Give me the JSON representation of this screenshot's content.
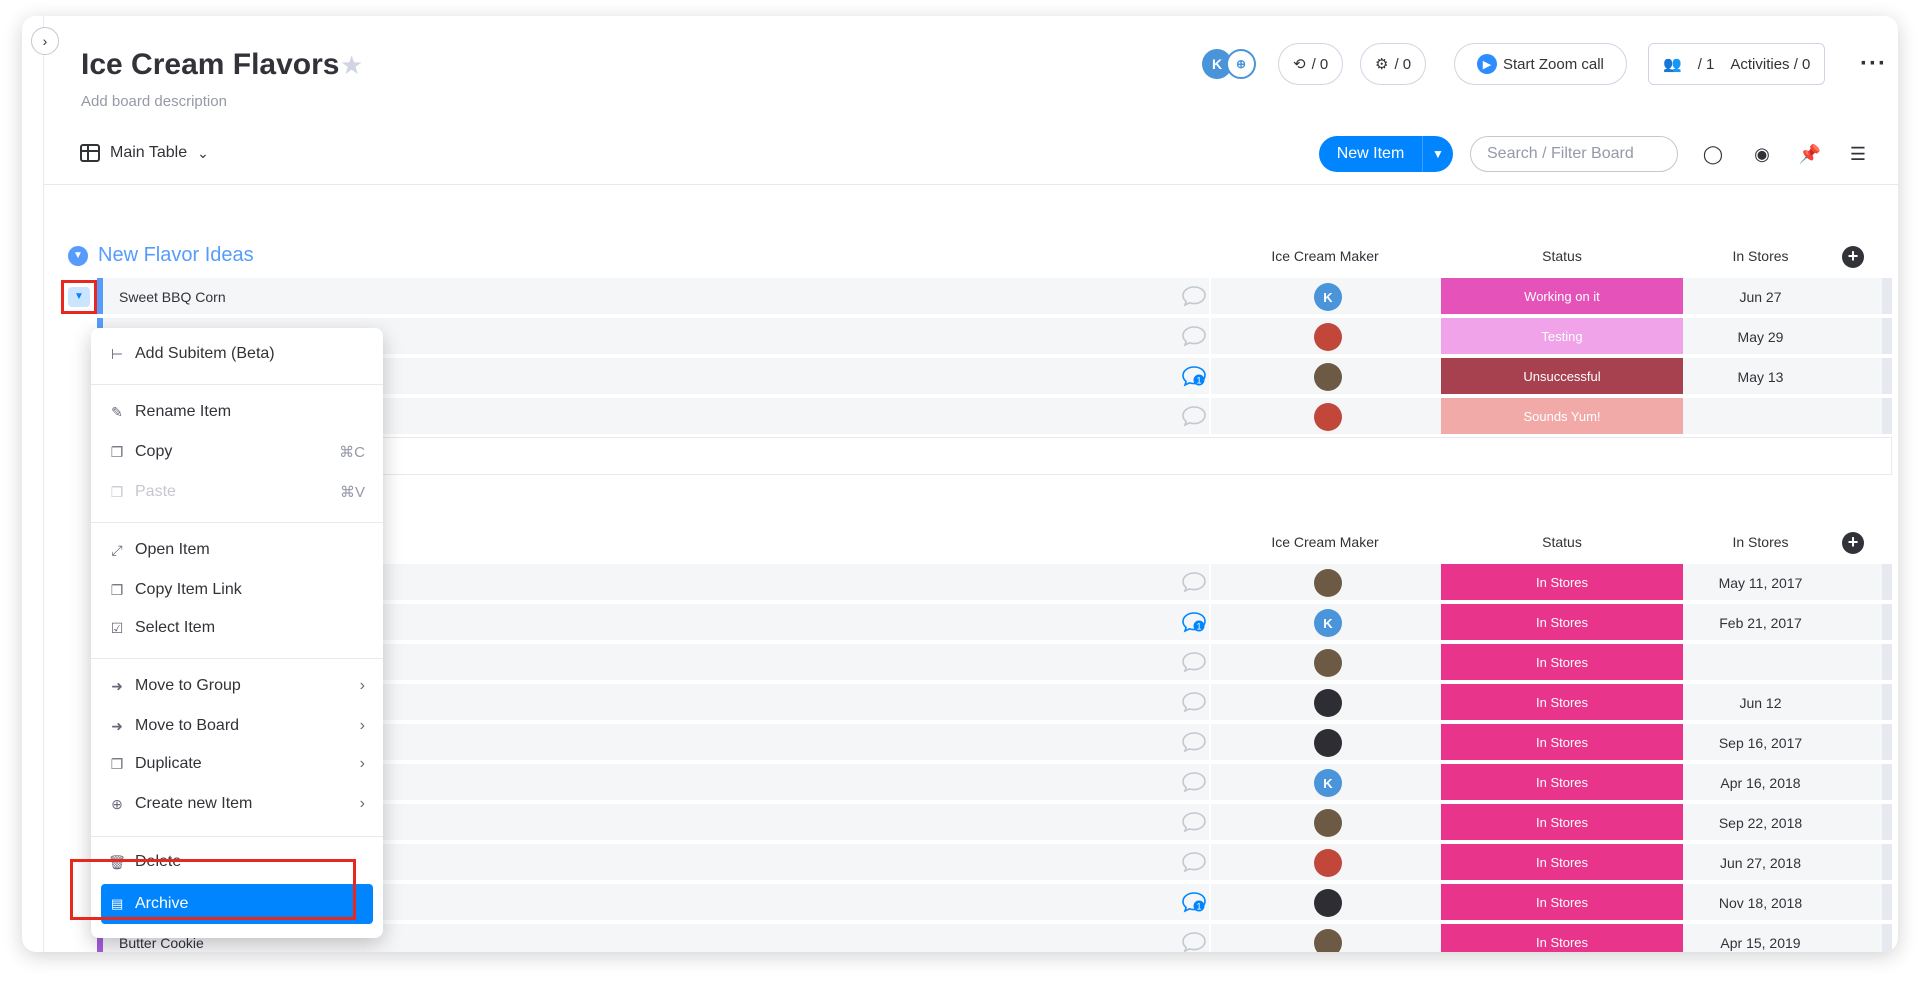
{
  "board": {
    "title": "Ice Cream Flavors",
    "description": "Add board description",
    "avatar_initial": "K",
    "updates_count": "/ 0",
    "automations_count": "/ 0",
    "zoom_label": "Start Zoom call",
    "members_count": "/ 1",
    "activities_label": "Activities / 0"
  },
  "toolbar": {
    "view_label": "Main Table",
    "new_item_label": "New Item",
    "search_placeholder": "Search / Filter Board"
  },
  "columns": {
    "maker": "Ice Cream Maker",
    "status": "Status",
    "stores": "In Stores"
  },
  "group1": {
    "name": "New Flavor Ideas",
    "color": "#579bfc",
    "rows": [
      {
        "name": "Sweet BBQ Corn",
        "maker": "K",
        "status": "Working on it",
        "status_color": "#e2445c",
        "date": "Jun 27",
        "updates": ""
      },
      {
        "name": "",
        "maker": "photo-woman",
        "status": "Testing",
        "status_color": "#ff9ee0",
        "date": "May 29",
        "updates": ""
      },
      {
        "name": "",
        "maker": "photo-pug",
        "status": "Unsuccessful",
        "status_color": "#a7414f",
        "date": "May 13",
        "updates": "1"
      },
      {
        "name": "",
        "maker": "photo-woman",
        "status": "Sounds Yum!",
        "status_color": "#f2aaa8",
        "date": "",
        "updates": ""
      }
    ]
  },
  "group2": {
    "color": "#a25ddc",
    "rows": [
      {
        "name": "",
        "maker": "photo-pug",
        "status": "In Stores",
        "date": "May 11, 2017",
        "updates": ""
      },
      {
        "name": "",
        "maker": "K",
        "status": "In Stores",
        "date": "Feb 21, 2017",
        "updates": "1"
      },
      {
        "name": "",
        "maker": "photo-pug",
        "status": "In Stores",
        "date": "",
        "updates": ""
      },
      {
        "name": "",
        "maker": "photo-dark",
        "status": "In Stores",
        "date": "Jun 12",
        "updates": ""
      },
      {
        "name": "",
        "maker": "photo-dark",
        "status": "In Stores",
        "date": "Sep 16, 2017",
        "updates": ""
      },
      {
        "name": "",
        "maker": "K",
        "status": "In Stores",
        "date": "Apr 16, 2018",
        "updates": ""
      },
      {
        "name": "",
        "maker": "photo-pug",
        "status": "In Stores",
        "date": "Sep 22, 2018",
        "updates": ""
      },
      {
        "name": "",
        "maker": "photo-woman",
        "status": "In Stores",
        "date": "Jun 27, 2018",
        "updates": ""
      },
      {
        "name": "",
        "maker": "photo-dark",
        "status": "In Stores",
        "date": "Nov 18, 2018",
        "updates": "1"
      },
      {
        "name": "Butter Cookie",
        "maker": "photo-pug",
        "status": "In Stores",
        "date": "Apr 15, 2019",
        "updates": ""
      }
    ],
    "status_color": "#e8348a"
  },
  "menu": {
    "add_subitem": "Add Subitem (Beta)",
    "rename": "Rename Item",
    "copy": "Copy",
    "copy_shortcut": "⌘C",
    "paste": "Paste",
    "paste_shortcut": "⌘V",
    "open": "Open Item",
    "copy_link": "Copy Item Link",
    "select": "Select Item",
    "move_group": "Move to Group",
    "move_board": "Move to Board",
    "duplicate": "Duplicate",
    "create_new": "Create new Item",
    "delete": "Delete",
    "archive": "Archive"
  }
}
